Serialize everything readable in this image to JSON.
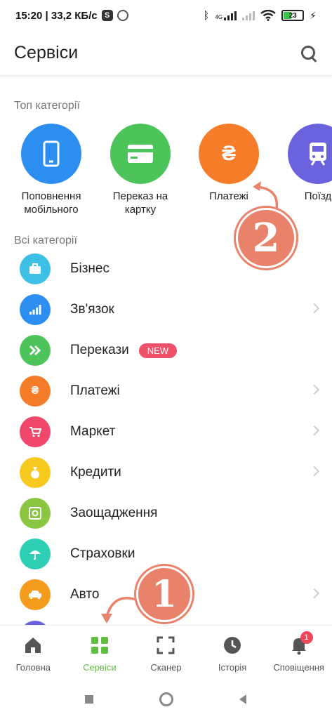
{
  "status_bar": {
    "time_speed": "15:20 | 33,2 КБ/с",
    "s_badge": "S",
    "network": "4G",
    "battery": "23"
  },
  "header": {
    "title": "Сервіси"
  },
  "top_categories": {
    "title": "Топ категорії",
    "items": [
      {
        "label": "Поповнення мобільного",
        "icon": "phone-icon",
        "color": "#2b8ef0"
      },
      {
        "label": "Переказ на картку",
        "icon": "card-icon",
        "color": "#4cc45a"
      },
      {
        "label": "Платежі",
        "icon": "hryvnia-icon",
        "glyph": "₴",
        "color": "#f57c28"
      },
      {
        "label": "Поїзд",
        "icon": "train-icon",
        "color": "#6a63dd"
      }
    ]
  },
  "all_categories": {
    "title": "Всі категорії",
    "items": [
      {
        "label": "Бізнес",
        "icon": "briefcase-icon",
        "color": "#3ec0e6"
      },
      {
        "label": "Зв'язок",
        "icon": "signal-icon",
        "color": "#2b8ef0"
      },
      {
        "label": "Перекази",
        "icon": "transfer-icon",
        "color": "#4cc45a",
        "badge": "NEW"
      },
      {
        "label": "Платежі",
        "icon": "hryvnia-icon",
        "glyph": "₴",
        "color": "#f57c28"
      },
      {
        "label": "Маркет",
        "icon": "cart-icon",
        "color": "#f0476a"
      },
      {
        "label": "Кредити",
        "icon": "moneybag-icon",
        "color": "#f7c81e"
      },
      {
        "label": "Заощадження",
        "icon": "safe-icon",
        "color": "#8ac642"
      },
      {
        "label": "Страховки",
        "icon": "umbrella-icon",
        "color": "#2ecfb5"
      },
      {
        "label": "Авто",
        "icon": "car-icon",
        "color": "#f59b1e"
      }
    ]
  },
  "annotations": {
    "one": "1",
    "two": "2"
  },
  "bottom_nav": {
    "items": [
      {
        "label": "Головна",
        "icon": "home-icon"
      },
      {
        "label": "Сервіси",
        "icon": "grid-icon"
      },
      {
        "label": "Сканер",
        "icon": "scanner-icon"
      },
      {
        "label": "Історія",
        "icon": "clock-icon"
      },
      {
        "label": "Сповіщення",
        "icon": "bell-icon",
        "badge": "1"
      }
    ]
  },
  "colors": {
    "accent_green": "#5fbf3f",
    "annotation": "#e9826a"
  }
}
